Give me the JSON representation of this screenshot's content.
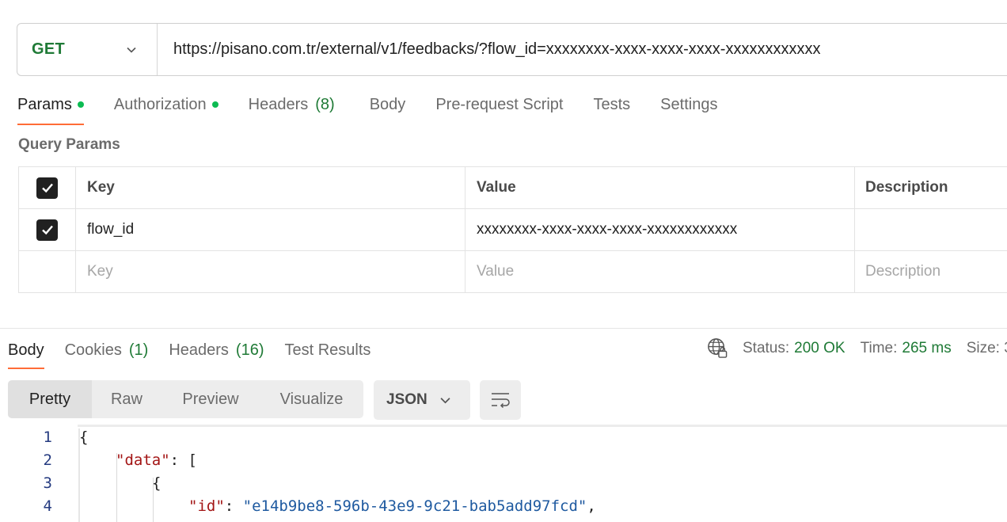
{
  "request": {
    "method": "GET",
    "url": "https://pisano.com.tr/external/v1/feedbacks/?flow_id=xxxxxxxx-xxxx-xxxx-xxxx-xxxxxxxxxxxx"
  },
  "request_tabs": {
    "params": "Params",
    "authorization": "Authorization",
    "headers": "Headers",
    "headers_count": "(8)",
    "body": "Body",
    "prerequest": "Pre-request Script",
    "tests": "Tests",
    "settings": "Settings"
  },
  "query_params": {
    "title": "Query Params",
    "headers": {
      "key": "Key",
      "value": "Value",
      "description": "Description"
    },
    "rows": [
      {
        "key": "flow_id",
        "value": "xxxxxxxx-xxxx-xxxx-xxxx-xxxxxxxxxxxx",
        "description": ""
      }
    ],
    "placeholders": {
      "key": "Key",
      "value": "Value",
      "description": "Description"
    }
  },
  "response_tabs": {
    "body": "Body",
    "cookies": "Cookies",
    "cookies_count": "(1)",
    "headers": "Headers",
    "headers_count": "(16)",
    "test_results": "Test Results"
  },
  "status_bar": {
    "status_label": "Status:",
    "status_value": "200 OK",
    "time_label": "Time:",
    "time_value": "265 ms",
    "size_label": "Size: 3"
  },
  "view_modes": {
    "pretty": "Pretty",
    "raw": "Raw",
    "preview": "Preview",
    "visualize": "Visualize"
  },
  "format": "JSON",
  "code": {
    "lines": [
      {
        "num": "1",
        "open": "{"
      },
      {
        "num": "2",
        "key": "\"data\"",
        "rest": ": ["
      },
      {
        "num": "3",
        "open": "{"
      },
      {
        "num": "4",
        "key": "\"id\"",
        "sep": ": ",
        "str": "\"e14b9be8-596b-43e9-9c21-bab5add97fcd\"",
        "rest": ","
      }
    ]
  },
  "colors": {
    "accent": "#ff6c37",
    "method": "#1f7a36",
    "dot": "#0cbb52"
  }
}
